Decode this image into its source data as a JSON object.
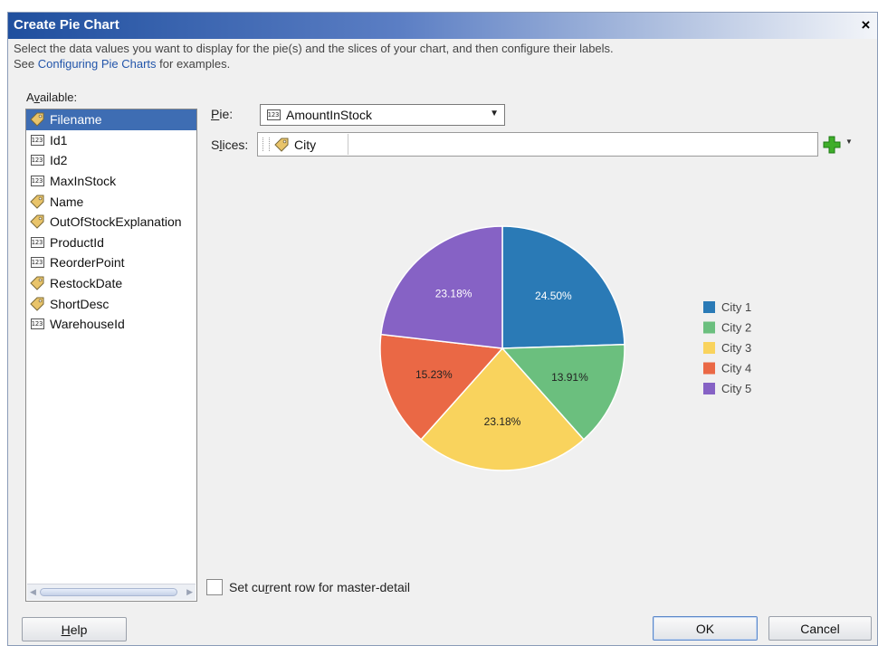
{
  "dialog": {
    "title": "Create Pie Chart",
    "close_glyph": "×",
    "instructions_line1": "Select the data values you want to display for the pie(s) and the slices of your chart, and then configure their labels.",
    "instructions_see": "See ",
    "instructions_link": "Configuring Pie Charts",
    "instructions_tail": " for examples."
  },
  "available": {
    "label_prefix": "A",
    "label_access": "v",
    "label_rest": "ailable:",
    "items": [
      {
        "label": "Filename",
        "icon": "tag-icon",
        "selected": true
      },
      {
        "label": "Id1",
        "icon": "number-icon"
      },
      {
        "label": "Id2",
        "icon": "number-icon"
      },
      {
        "label": "MaxInStock",
        "icon": "number-icon"
      },
      {
        "label": "Name",
        "icon": "tag-icon"
      },
      {
        "label": "OutOfStockExplanation",
        "icon": "tag-icon"
      },
      {
        "label": "ProductId",
        "icon": "number-icon"
      },
      {
        "label": "ReorderPoint",
        "icon": "number-icon"
      },
      {
        "label": "RestockDate",
        "icon": "tag-icon"
      },
      {
        "label": "ShortDesc",
        "icon": "tag-icon"
      },
      {
        "label": "WarehouseId",
        "icon": "number-icon"
      }
    ],
    "number_icon_text": "123"
  },
  "pie": {
    "label_access": "P",
    "label_rest": "ie:",
    "selected_value": "AmountInStock"
  },
  "slices": {
    "label_prefix": "S",
    "label_access": "l",
    "label_rest": "ices:",
    "chip_label": "City"
  },
  "chart_data": {
    "type": "pie",
    "categories": [
      "City 1",
      "City 2",
      "City 3",
      "City 4",
      "City 5"
    ],
    "values": [
      24.5,
      13.91,
      23.18,
      15.23,
      23.18
    ],
    "labels": [
      "24.50%",
      "13.91%",
      "23.18%",
      "15.23%",
      "23.18%"
    ],
    "colors": [
      "#2a7ab6",
      "#6bbf7e",
      "#f9d35d",
      "#ea6845",
      "#8662c5"
    ],
    "label_colors": [
      "#ffffff",
      "#222222",
      "#222222",
      "#222222",
      "#ffffff"
    ],
    "legend_position": "right"
  },
  "master_detail": {
    "pre": "Set cu",
    "access": "r",
    "post": "rent row for master-detail",
    "checked": false
  },
  "buttons": {
    "help_access": "H",
    "help_rest": "elp",
    "ok": "OK",
    "cancel": "Cancel"
  },
  "colors": {
    "selection": "#3e6db3",
    "link": "#2255aa",
    "title_gradient_start": "#1f4f9e"
  }
}
